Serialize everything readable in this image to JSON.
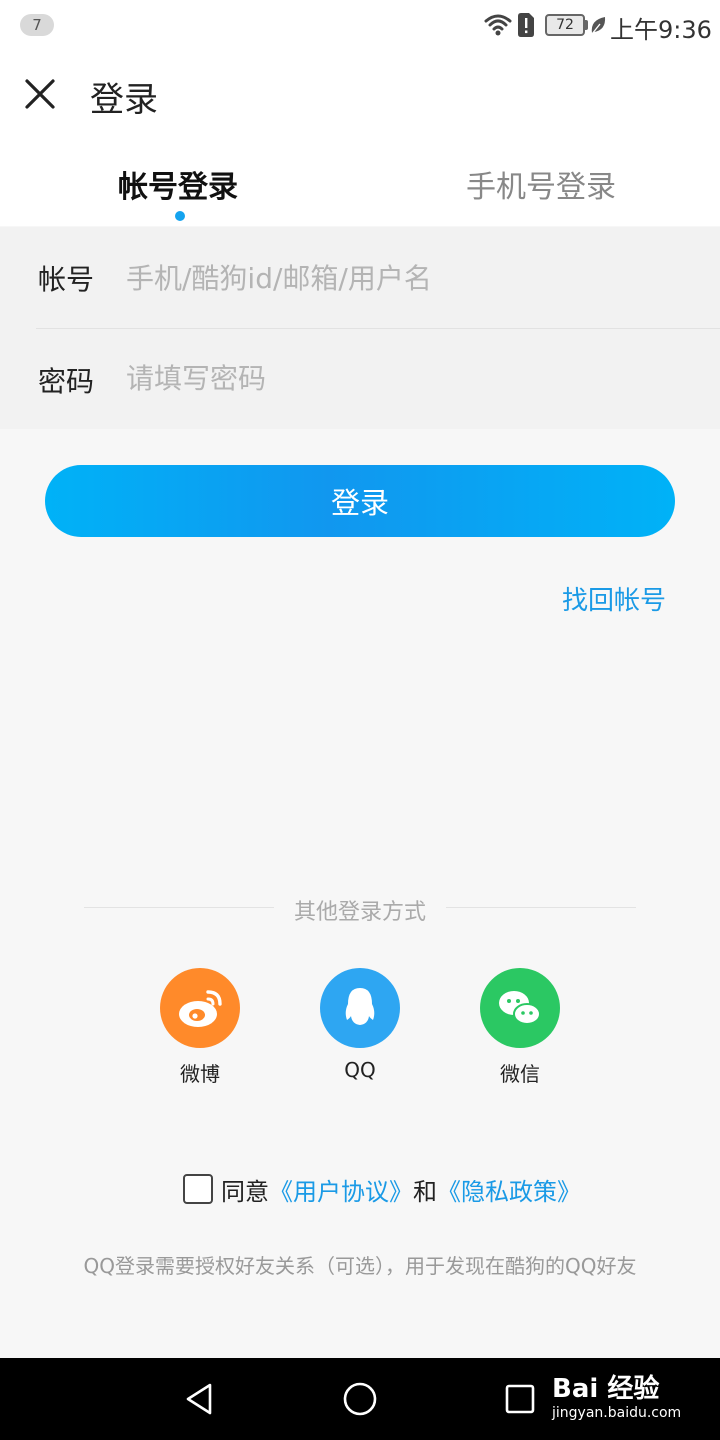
{
  "status_bar": {
    "notification_count": "7",
    "battery_level": "72",
    "time": "上午9:36",
    "icons": [
      "wifi-icon",
      "sim-alert-icon",
      "battery-icon",
      "leaf-icon"
    ]
  },
  "header": {
    "close_icon": "close-icon",
    "title": "登录"
  },
  "tabs": [
    {
      "label": "帐号登录",
      "active": true
    },
    {
      "label": "手机号登录",
      "active": false
    }
  ],
  "form": {
    "account_label": "帐号",
    "account_placeholder": "手机/酷狗id/邮箱/用户名",
    "password_label": "密码",
    "password_placeholder": "请填写密码"
  },
  "login_button": "登录",
  "recover_link": "找回帐号",
  "other_login": {
    "title": "其他登录方式",
    "options": [
      {
        "label": "微博",
        "icon": "weibo-icon",
        "color": "#ff8a2a"
      },
      {
        "label": "QQ",
        "icon": "qq-icon",
        "color": "#2ea6f2"
      },
      {
        "label": "微信",
        "icon": "wechat-icon",
        "color": "#2bc863"
      }
    ]
  },
  "agreement": {
    "prefix": "同意",
    "user_agreement": "《用户协议》",
    "and": "和",
    "privacy_policy": "《隐私政策》",
    "checked": false
  },
  "qq_note": "QQ登录需要授权好友关系（可选），用于发现在酷狗的QQ好友",
  "nav_bar": {
    "icons": [
      "back-icon",
      "home-icon",
      "recent-apps-icon"
    ]
  },
  "watermark": {
    "brand": "Bai 经验",
    "url": "jingyan.baidu.com"
  },
  "colors": {
    "accent": "#14a3ef",
    "link": "#1a9ae6"
  }
}
